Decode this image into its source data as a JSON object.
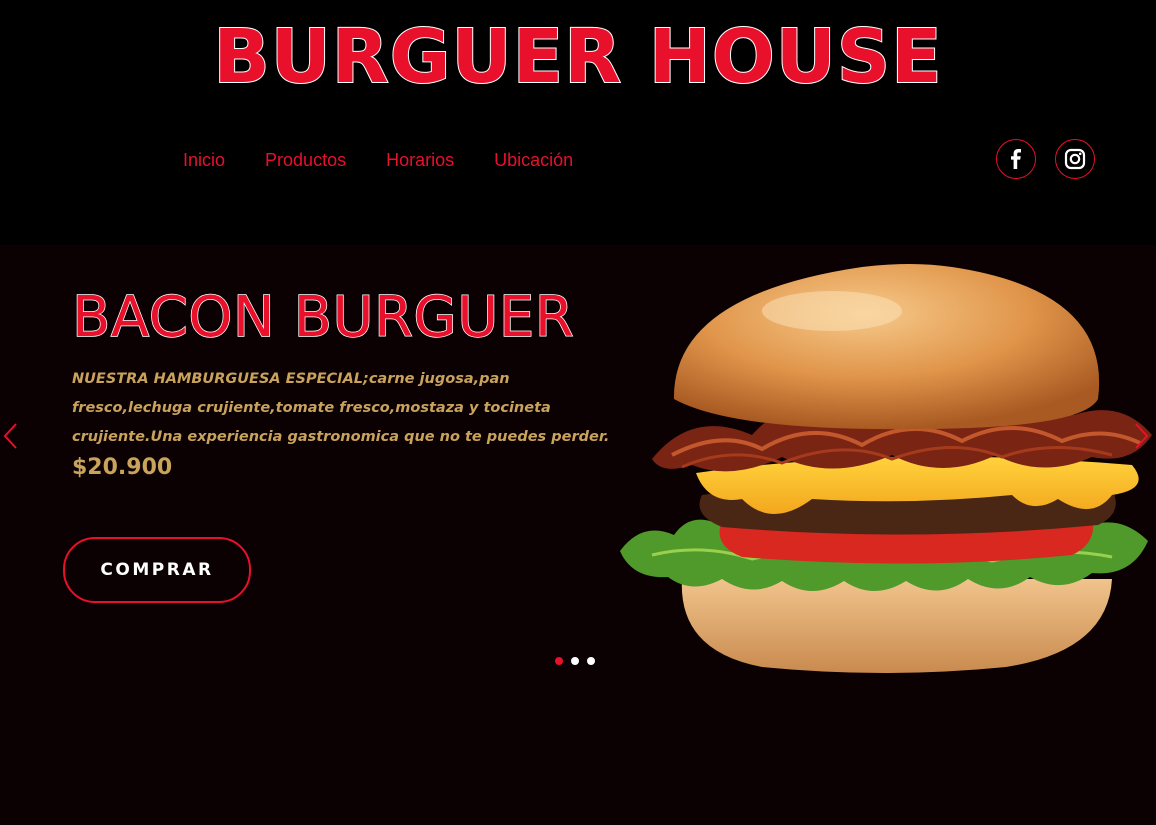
{
  "header": {
    "brand": "BURGUER HOUSE",
    "nav": [
      {
        "label": "Inicio"
      },
      {
        "label": "Productos"
      },
      {
        "label": "Horarios"
      },
      {
        "label": "Ubicación"
      }
    ],
    "social": [
      {
        "icon": "facebook-icon"
      },
      {
        "icon": "instagram-icon"
      }
    ]
  },
  "hero": {
    "title": "BACON BURGUER",
    "description": "NUESTRA HAMBURGUESA ESPECIAL;carne  jugosa,pan fresco,lechuga crujiente,tomate fresco,mostaza y tocineta crujiente.Una experiencia gastronomica que no te puedes perder.",
    "price": "$20.900",
    "button_label": "COMPRAR",
    "image": "bacon-burger-image",
    "slides": {
      "count": 3,
      "active": 1
    },
    "arrows": {
      "prev": "chevron-left-icon",
      "next": "chevron-right-icon"
    }
  },
  "colors": {
    "accent": "#e8102a",
    "gold": "#c9a25b",
    "background": "#000000",
    "hero_background": "#0b0103"
  }
}
